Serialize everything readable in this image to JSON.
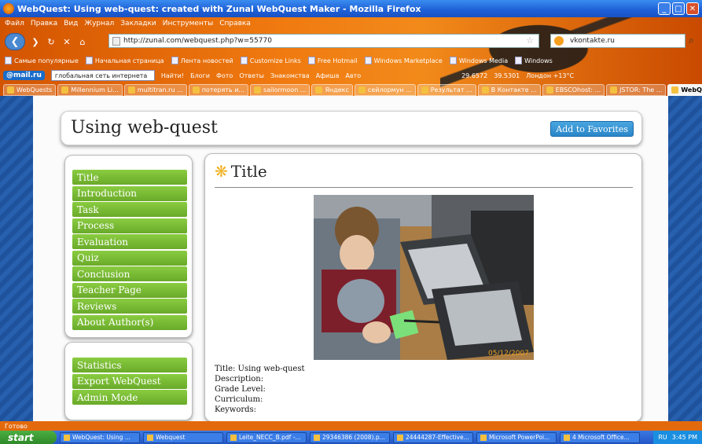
{
  "window": {
    "title": "WebQuest: Using web-quest: created with Zunal WebQuest Maker - Mozilla Firefox"
  },
  "menu": [
    "Файл",
    "Правка",
    "Вид",
    "Журнал",
    "Закладки",
    "Инструменты",
    "Справка"
  ],
  "address": {
    "url": "http://zunal.com/webquest.php?w=55770"
  },
  "search": {
    "value": "vkontakte.ru"
  },
  "bookmarks": [
    "Самые популярные",
    "Начальная страница",
    "Лента новостей",
    "Customize Links",
    "Free Hotmail",
    "Windows Marketplace",
    "Windows Media",
    "Windows"
  ],
  "mailbar": {
    "logo": "@mail.ru",
    "search": "глобальная сеть интернета",
    "find": "Найти!",
    "items": [
      "Блоги",
      "Фото",
      "Ответы",
      "Знакомства",
      "Афиша",
      "Авто"
    ],
    "rates": [
      "29.6572",
      "39.5301"
    ],
    "weather": "Лондон +13°C"
  },
  "tabs": [
    "WebQuests",
    "Millennium Li...",
    "multitran.ru ...",
    "потерять и...",
    "sailormoon ...",
    "Яндекс",
    "сейлормун ...",
    "Результат ...",
    "В Контакте ...",
    "EBSCOhost: ...",
    "JSTOR: The ...",
    "WebQ..."
  ],
  "page": {
    "title": "Using web-quest",
    "favorites_label": "Add to Favorites",
    "nav": [
      "Title",
      "Introduction",
      "Task",
      "Process",
      "Evaluation",
      "Quiz",
      "Conclusion",
      "Teacher Page",
      "Reviews",
      "About Author(s)"
    ],
    "nav2": [
      "Statistics",
      "Export WebQuest",
      "Admin Mode"
    ],
    "section_title": "Title",
    "photo_date": "05/12/2007",
    "meta": {
      "title": "Title: Using web-quest",
      "description": "Description:",
      "grade": "Grade Level:",
      "curriculum": "Curriculum:",
      "keywords": "Keywords:"
    }
  },
  "status": "Готово",
  "taskbar": {
    "start": "start",
    "items": [
      "WebQuest: Using ...",
      "Webquest",
      "Leite_NECC_B.pdf -...",
      "29346386 (2008).p...",
      "24444287-Effective...",
      "Microsoft PowerPoi...",
      "4 Microsoft Office..."
    ],
    "lang": "RU",
    "time": "3:45 PM"
  }
}
